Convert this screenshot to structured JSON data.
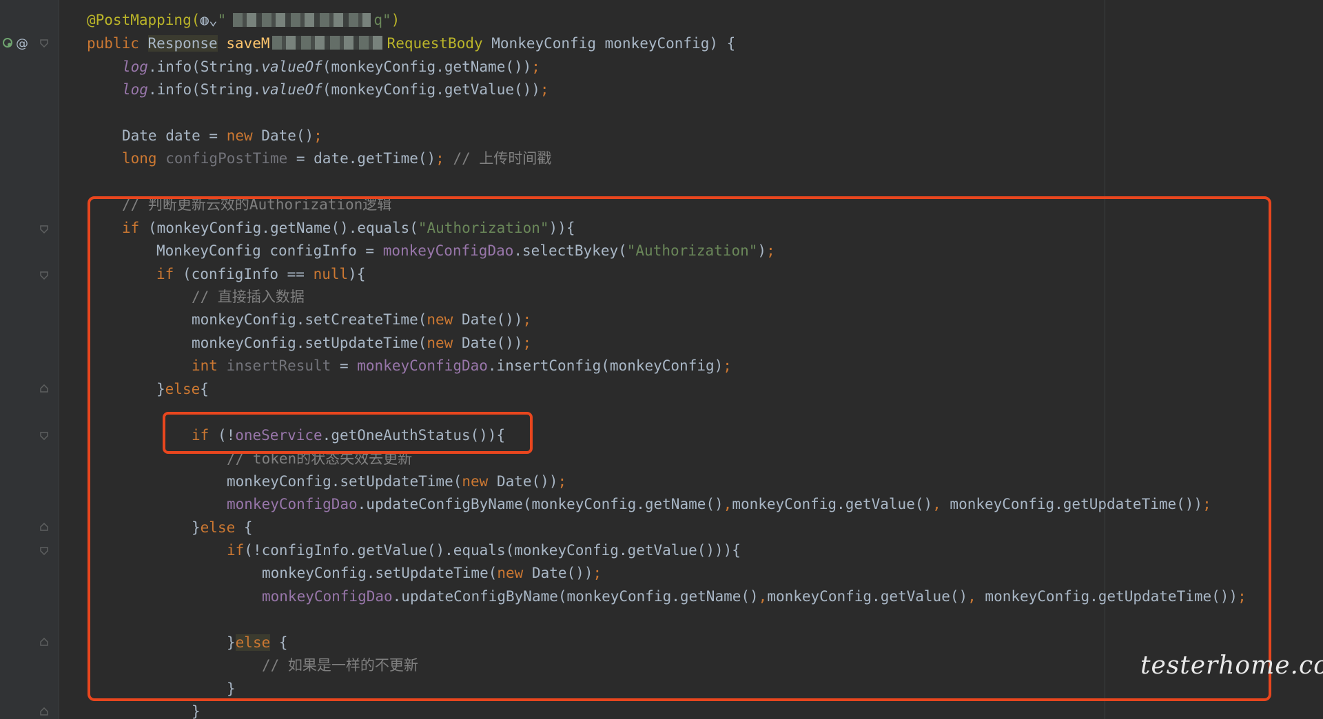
{
  "code": {
    "line_annotation": {
      "prefix": "@PostMapping(",
      "value_start": "\"",
      "value_end": "q\"",
      "suffix": ")"
    },
    "line_signature": {
      "kw_public": "public ",
      "type_response": "Response",
      "space": " ",
      "method_visible": "saveM",
      "ann_requestbody": "RequestBody",
      "params": " MonkeyConfig monkeyConfig) {"
    },
    "line_log1": {
      "log": "log",
      "mid": ".info(String.",
      "valueof": "valueOf",
      "args": "(monkeyConfig.getName())",
      "semi": ";"
    },
    "line_log2": {
      "log": "log",
      "mid": ".info(String.",
      "valueof": "valueOf",
      "args": "(monkeyConfig.getValue())",
      "semi": ";"
    },
    "line_date": {
      "start": "Date date = ",
      "kw_new": "new",
      "end": " Date()",
      "semi": ";"
    },
    "line_posttime": {
      "kw_long": "long",
      "var": " configPostTime",
      "mid": " = date.getTime()",
      "semi": ";",
      "comment": " // 上传时间戳"
    },
    "line_comment_auth": "// 判断更新云效的Authorization逻辑",
    "line_if_auth": {
      "kw_if": "if",
      "mid": " (monkeyConfig.getName().equals(",
      "str": "\"Authorization\"",
      "end": ")){"
    },
    "line_configinfo": {
      "start": "MonkeyConfig configInfo = ",
      "dao": "monkeyConfigDao",
      "mid": ".selectBykey(",
      "str": "\"Authorization\"",
      "end": ")",
      "semi": ";"
    },
    "line_if_null": {
      "kw_if": "if",
      "mid": " (configInfo == ",
      "kw_null": "null",
      "end": "){"
    },
    "line_comment_insert": "// 直接插入数据",
    "line_setcreate": {
      "start": "monkeyConfig.setCreateTime(",
      "kw_new": "new",
      "end": " Date())",
      "semi": ";"
    },
    "line_setupdate1": {
      "start": "monkeyConfig.setUpdateTime(",
      "kw_new": "new",
      "end": " Date())",
      "semi": ";"
    },
    "line_insert": {
      "kw_int": "int",
      "var": " insertResult",
      "mid": " = ",
      "dao": "monkeyConfigDao",
      "end": ".insertConfig(monkeyConfig)",
      "semi": ";"
    },
    "line_else1": {
      "brace": "}",
      "kw_else": "else",
      "end": "{"
    },
    "line_if_oneauth": {
      "kw_if": "if",
      "mid": " (!",
      "svc": "oneService",
      "end": ".getOneAuthStatus()){"
    },
    "line_comment_token": "// token的状态失效去更新",
    "line_setupdate2": {
      "start": "monkeyConfig.setUpdateTime(",
      "kw_new": "new",
      "end": " Date())",
      "semi": ";"
    },
    "line_updatebyname1": {
      "dao": "monkeyConfigDao",
      "a": ".updateConfigByName(monkeyConfig.getName()",
      "c1": ",",
      "b": "monkeyConfig.getValue()",
      "c2": ",",
      "c": " monkeyConfig.getUpdateTime())",
      "semi": ";"
    },
    "line_else2": {
      "brace": "}",
      "kw_else": "else",
      "end": " {"
    },
    "line_if_value": {
      "kw_if": "if",
      "end": "(!configInfo.getValue().equals(monkeyConfig.getValue())){"
    },
    "line_setupdate3": {
      "start": "monkeyConfig.setUpdateTime(",
      "kw_new": "new",
      "end": " Date())",
      "semi": ";"
    },
    "line_updatebyname2": {
      "dao": "monkeyConfigDao",
      "a": ".updateConfigByName(monkeyConfig.getName()",
      "c1": ",",
      "b": "monkeyConfig.getValue()",
      "c2": ",",
      "c": " monkeyConfig.getUpdateTime())",
      "semi": ";"
    },
    "line_else3": {
      "brace": "}",
      "kw_else": "else",
      "end": " {"
    },
    "line_comment_same": "// 如果是一样的不更新",
    "line_close1": "}",
    "line_close2": "}"
  },
  "gutter": {
    "marker_at": "@"
  },
  "watermark": "testerhome.com",
  "colors": {
    "background": "#2b2b2b",
    "gutter": "#313335",
    "keyword": "#cc7832",
    "string": "#6a8759",
    "comment": "#808080",
    "annotation": "#bbb529",
    "field": "#9876aa",
    "method": "#ffc66d",
    "text": "#a9b7c6",
    "highlight_box": "#e8461e"
  }
}
